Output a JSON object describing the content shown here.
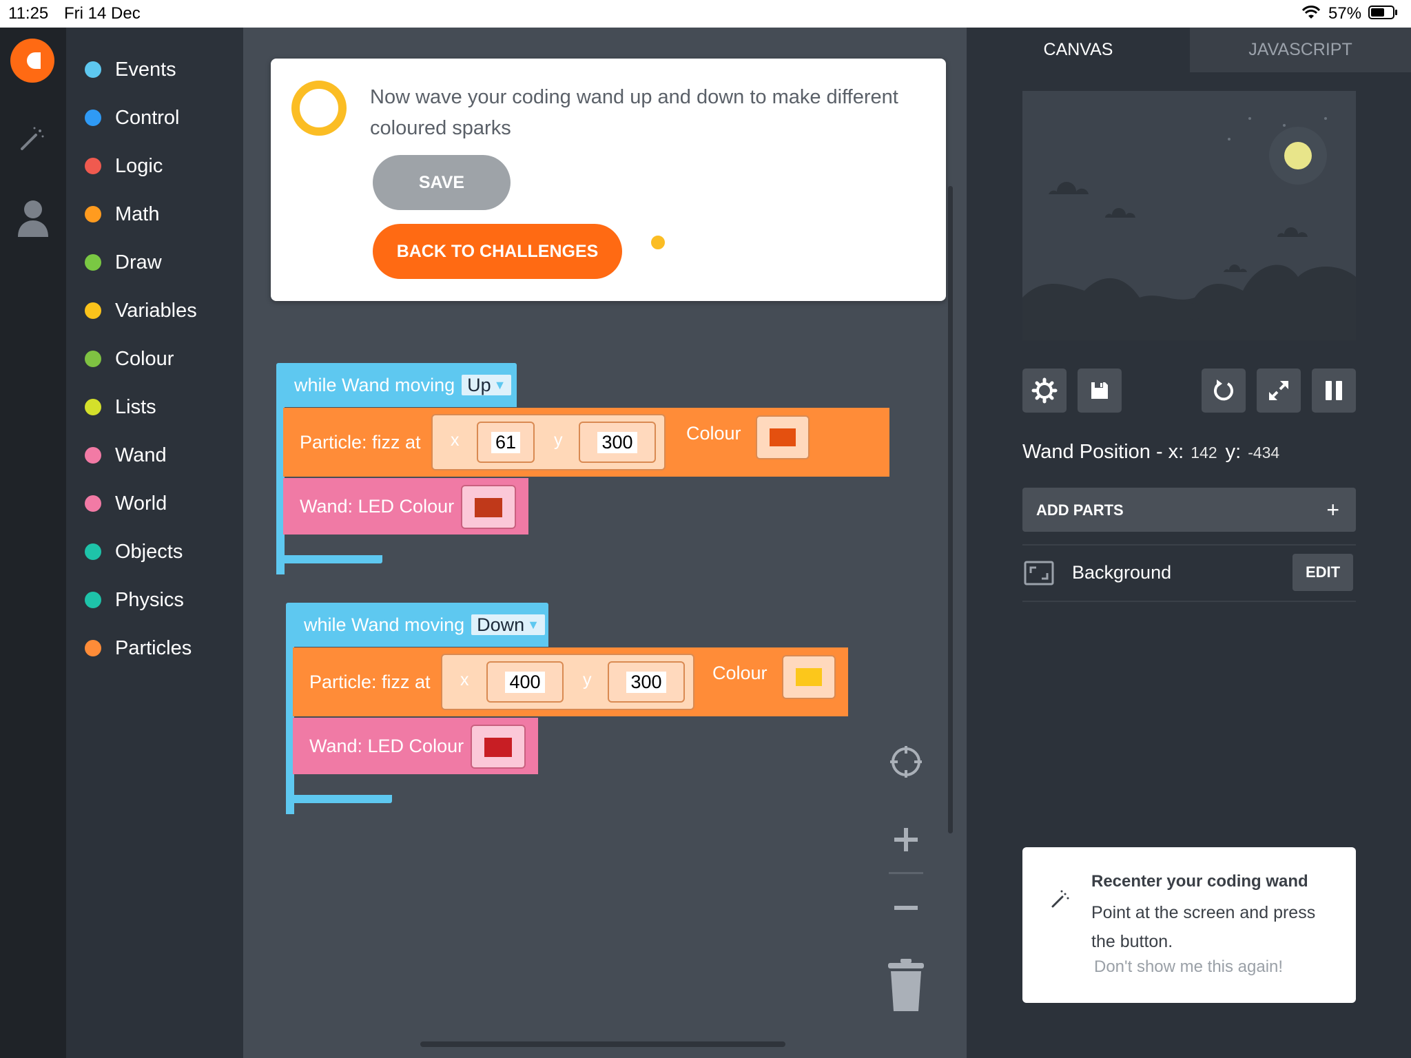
{
  "status_bar": {
    "time": "11:25",
    "date": "Fri 14 Dec",
    "battery": "57%"
  },
  "categories": [
    {
      "label": "Events",
      "color": "#5ec8f0"
    },
    {
      "label": "Control",
      "color": "#2f9af5"
    },
    {
      "label": "Logic",
      "color": "#f05a4f"
    },
    {
      "label": "Math",
      "color": "#ff9b1f"
    },
    {
      "label": "Draw",
      "color": "#7ac843"
    },
    {
      "label": "Variables",
      "color": "#fbc31b"
    },
    {
      "label": "Colour",
      "color": "#7fc242"
    },
    {
      "label": "Lists",
      "color": "#d4e02b"
    },
    {
      "label": "Wand",
      "color": "#f27aa5"
    },
    {
      "label": "World",
      "color": "#f27aa5"
    },
    {
      "label": "Objects",
      "color": "#1ec3a9"
    },
    {
      "label": "Physics",
      "color": "#1ec3a9"
    },
    {
      "label": "Particles",
      "color": "#ff8c38"
    }
  ],
  "challenge": {
    "message": "Now wave your coding wand up and down to make different coloured sparks",
    "save_label": "SAVE",
    "back_label": "BACK TO CHALLENGES"
  },
  "blocks": [
    {
      "event_label": "while Wand moving",
      "direction": "Up",
      "particle_label": "Particle: fizz at",
      "x_label": "x",
      "x": "61",
      "y_label": "y",
      "y": "300",
      "colour_label": "Colour",
      "particle_colour": "#e4500f",
      "led_label": "Wand: LED Colour",
      "led_colour": "#c0391a"
    },
    {
      "event_label": "while Wand moving",
      "direction": "Down",
      "particle_label": "Particle: fizz at",
      "x_label": "x",
      "x": "400",
      "y_label": "y",
      "y": "300",
      "colour_label": "Colour",
      "particle_colour": "#fcc71b",
      "led_label": "Wand: LED Colour",
      "led_colour": "#c81e24"
    }
  ],
  "right_panel": {
    "tabs": [
      "CANVAS",
      "JAVASCRIPT"
    ],
    "wand_position_label": "Wand Position - x:",
    "wand_x": "142",
    "wand_y_label": "y:",
    "wand_y": "-434",
    "add_parts_label": "ADD PARTS",
    "background_label": "Background",
    "edit_label": "EDIT"
  },
  "recenter": {
    "title": "Recenter your coding wand",
    "body": "Point at the screen and press the button.",
    "dismiss": "Don't show me this again!"
  }
}
